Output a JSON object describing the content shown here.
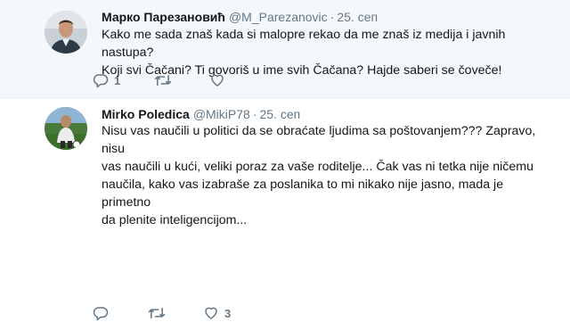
{
  "tweets": [
    {
      "name": "Марко Парезановић",
      "handle": "@M_Parezanovic",
      "dot": "·",
      "date": "25. сеп",
      "lines": [
        "Kako me sada znaš kada si malopre rekao da me znaš iz medija i javnih nastupa?",
        "Koji svi Čačani? Ti govoriš u ime svih Čačana? Hajde saberi se čoveče!"
      ],
      "reply_count": "1",
      "retweet_count": "",
      "like_count": ""
    },
    {
      "name": "Mirko Poledica",
      "handle": "@MikiP78",
      "dot": "·",
      "date": "25. сеп",
      "lines": [
        "Nisu vas naučili u politici da se obraćate ljudima sa poštovanjem??? Zapravo, nisu",
        "vas naučili u kući, veliki poraz za vaše roditelje... Čak vas ni tetka nije ničemu",
        "naučila, kako vas izabraše za poslanika to mi nikako nije jasno, mada je primetno",
        "da plenite inteligencijom..."
      ],
      "reply_count": "",
      "retweet_count": "",
      "like_count": "3"
    }
  ],
  "icons": {
    "reply": "reply-icon",
    "retweet": "retweet-icon",
    "like": "heart-icon"
  },
  "colors": {
    "highlight_bg": "#f5f8fa",
    "secondary_text": "#657786",
    "primary_text": "#14171a"
  }
}
